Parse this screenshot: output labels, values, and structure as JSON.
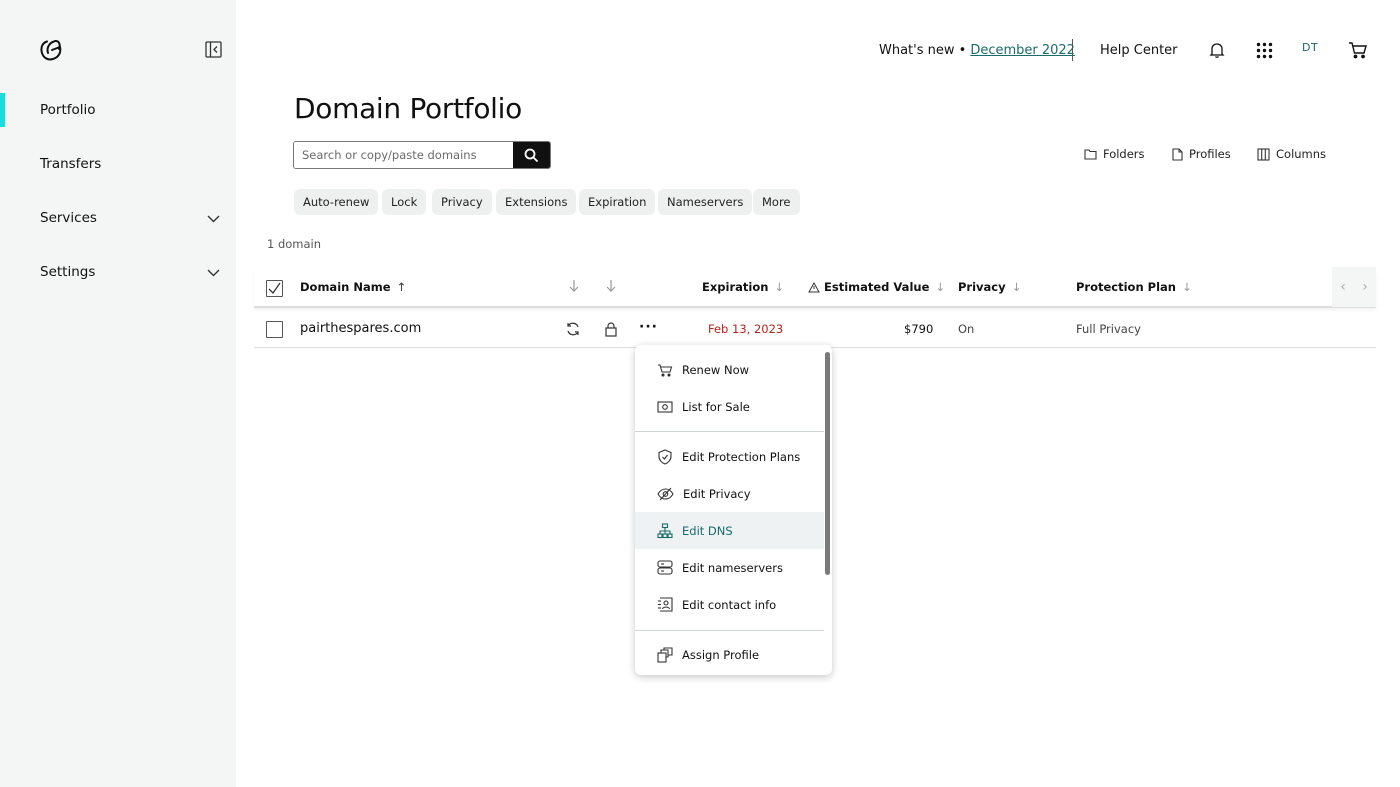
{
  "sidebar": {
    "items": [
      {
        "label": "Portfolio"
      },
      {
        "label": "Transfers"
      },
      {
        "label": "Services"
      },
      {
        "label": "Settings"
      }
    ]
  },
  "header": {
    "whats_new_prefix": "What's new •",
    "whats_new_link": "December 2022",
    "help_center": "Help Center",
    "avatar_initials": "DT",
    "accent_color": "#1bdbdb"
  },
  "main": {
    "title": "Domain Portfolio",
    "search": {
      "placeholder": "Search or copy/paste domains"
    },
    "tools": {
      "folders": "Folders",
      "profiles": "Profiles",
      "columns": "Columns"
    },
    "chips": [
      "Auto-renew",
      "Lock",
      "Privacy",
      "Extensions",
      "Expiration",
      "Nameservers",
      "More"
    ],
    "count": "1 domain"
  },
  "table": {
    "headers": {
      "domain": "Domain Name",
      "expiration": "Expiration",
      "value": "Estimated Value",
      "privacy": "Privacy",
      "protection": "Protection Plan"
    },
    "row": {
      "domain": "pairthespares.com",
      "expiration": "Feb 13, 2023",
      "value": "$790",
      "privacy": "On",
      "protection": "Full Privacy"
    }
  },
  "menu": {
    "items": [
      {
        "label": "Renew Now",
        "icon": "cart-icon"
      },
      {
        "label": "List for Sale",
        "icon": "money-icon"
      },
      {
        "label": "Edit Protection Plans",
        "icon": "shield-icon"
      },
      {
        "label": "Edit Privacy",
        "icon": "eye-off-icon"
      },
      {
        "label": "Edit DNS",
        "icon": "dns-icon",
        "highlighted": true
      },
      {
        "label": "Edit nameservers",
        "icon": "server-icon"
      },
      {
        "label": "Edit contact info",
        "icon": "contact-icon"
      },
      {
        "label": "Assign Profile",
        "icon": "profile-icon"
      }
    ]
  }
}
